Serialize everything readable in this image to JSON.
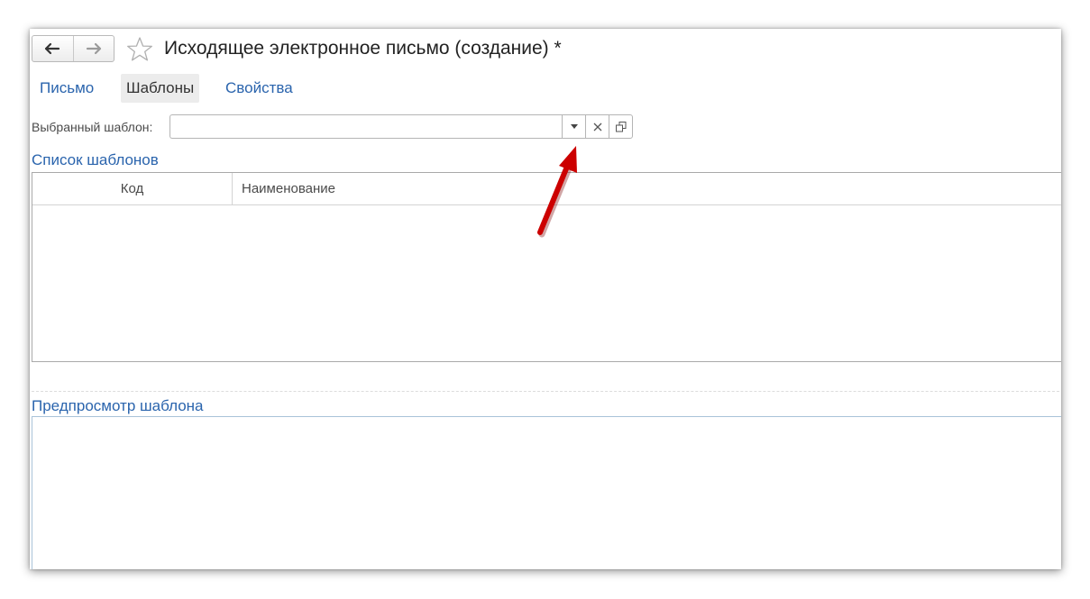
{
  "window": {
    "title": "Исходящее электронное письмо (создание) *"
  },
  "icons": {
    "back": "arrow-left-icon",
    "forward": "arrow-right-icon",
    "favorite": "star-outline-icon",
    "dropdown": "dropdown-triangle-icon",
    "clear": "clear-x-icon",
    "open": "open-window-icon"
  },
  "tabs": [
    {
      "label": "Письмо",
      "active": false
    },
    {
      "label": "Шаблоны",
      "active": true
    },
    {
      "label": "Свойства",
      "active": false
    }
  ],
  "template_field": {
    "label": "Выбранный шаблон:",
    "value": "",
    "placeholder": ""
  },
  "templates_list": {
    "title": "Список шаблонов",
    "columns": [
      "Код",
      "Наименование"
    ],
    "rows": []
  },
  "preview": {
    "title": "Предпросмотр шаблона"
  },
  "colors": {
    "link_blue": "#2a64ad",
    "annotation_arrow": "#cc0000"
  }
}
